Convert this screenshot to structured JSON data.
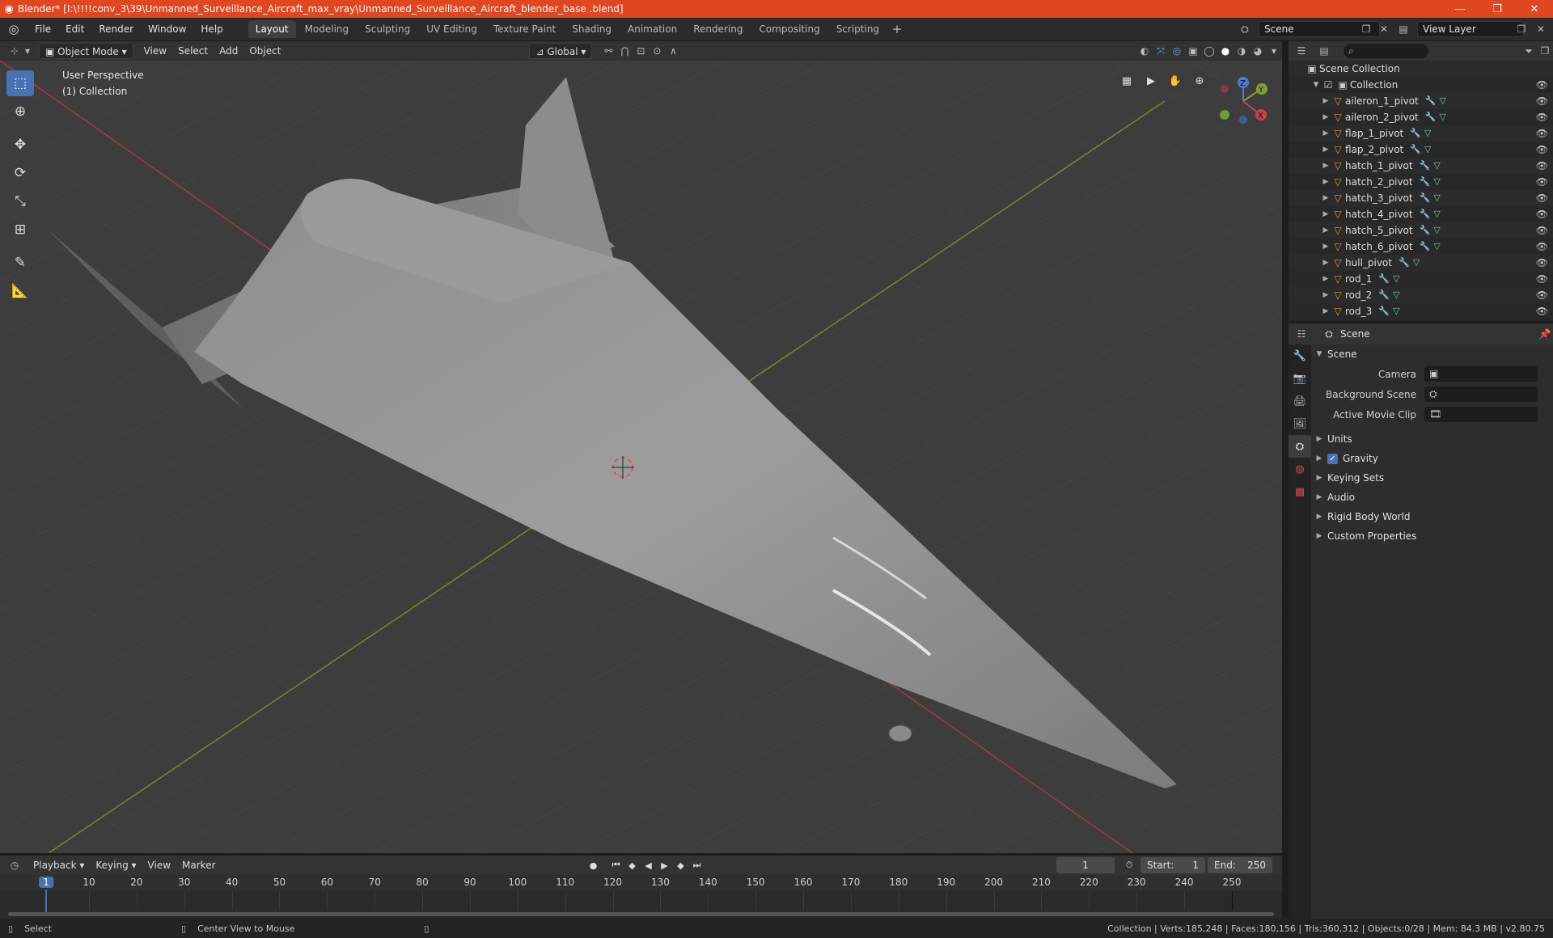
{
  "window": {
    "title": "Blender* [I:\\!!!!conv_3\\39\\Unmanned_Surveillance_Aircraft_max_vray\\Unmanned_Surveillance_Aircraft_blender_base .blend]",
    "minimize": "—",
    "restore": "❐",
    "close": "✕"
  },
  "menu": [
    "File",
    "Edit",
    "Render",
    "Window",
    "Help"
  ],
  "workspaces": [
    "Layout",
    "Modeling",
    "Sculpting",
    "UV Editing",
    "Texture Paint",
    "Shading",
    "Animation",
    "Rendering",
    "Compositing",
    "Scripting"
  ],
  "workspace_add": "+",
  "scene_name": "Scene",
  "view_layer": "View Layer",
  "viewport_header": {
    "mode": "Object Mode",
    "menus": [
      "View",
      "Select",
      "Add",
      "Object"
    ],
    "orientation": "Global"
  },
  "viewport": {
    "perspective": "User Perspective",
    "collection": "(1) Collection"
  },
  "gizmo": {
    "x": "X",
    "y": "Y",
    "z": "Z"
  },
  "outliner": {
    "root": "Scene Collection",
    "collection": "Collection",
    "items": [
      "aileron_1_pivot",
      "aileron_2_pivot",
      "flap_1_pivot",
      "flap_2_pivot",
      "hatch_1_pivot",
      "hatch_2_pivot",
      "hatch_3_pivot",
      "hatch_4_pivot",
      "hatch_5_pivot",
      "hatch_6_pivot",
      "hull_pivot",
      "rod_1",
      "rod_2",
      "rod_3"
    ]
  },
  "properties": {
    "context": "Scene",
    "panel": "Scene",
    "camera_label": "Camera",
    "background_label": "Background Scene",
    "movieclip_label": "Active Movie Clip",
    "sections": [
      "Units",
      "Gravity",
      "Keying Sets",
      "Audio",
      "Rigid Body World",
      "Custom Properties"
    ]
  },
  "timeline": {
    "menus": [
      "Playback",
      "Keying",
      "View",
      "Marker"
    ],
    "current_frame": "1",
    "start_label": "Start:",
    "start": "1",
    "end_label": "End:",
    "end": "250",
    "ticks": [
      "1",
      "10",
      "20",
      "30",
      "40",
      "50",
      "60",
      "70",
      "80",
      "90",
      "100",
      "110",
      "120",
      "130",
      "140",
      "150",
      "160",
      "170",
      "180",
      "190",
      "200",
      "210",
      "220",
      "230",
      "240",
      "250"
    ]
  },
  "status": {
    "left": "Select",
    "middle": "Center View to Mouse",
    "right": "Collection | Verts:185,248 | Faces:180,156 | Tris:360,312 | Objects:0/28 | Mem: 84.3 MB | v2.80.75"
  }
}
